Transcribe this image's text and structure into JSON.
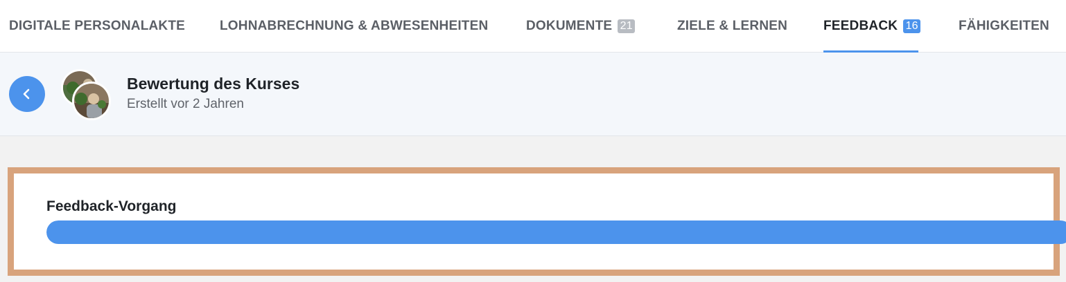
{
  "tabs": [
    {
      "label": "DIGITALE PERSONALAKTE",
      "badge": null,
      "active": false
    },
    {
      "label": "LOHNABRECHNUNG & ABWESENHEITEN",
      "badge": null,
      "active": false
    },
    {
      "label": "DOKUMENTE",
      "badge": "21",
      "active": false
    },
    {
      "label": "ZIELE & LERNEN",
      "badge": null,
      "active": false
    },
    {
      "label": "FEEDBACK",
      "badge": "16",
      "active": true
    },
    {
      "label": "FÄHIGKEITEN",
      "badge": null,
      "active": false
    }
  ],
  "header": {
    "title": "Bewertung des Kurses",
    "subtitle": "Erstellt vor 2 Jahren"
  },
  "feedback": {
    "title": "Feedback-Vorgang",
    "progress": 1.0
  },
  "colors": {
    "accent": "#4c93ec",
    "highlight_frame": "#d8a37c"
  },
  "icons": {
    "back": "chevron-left-icon"
  }
}
